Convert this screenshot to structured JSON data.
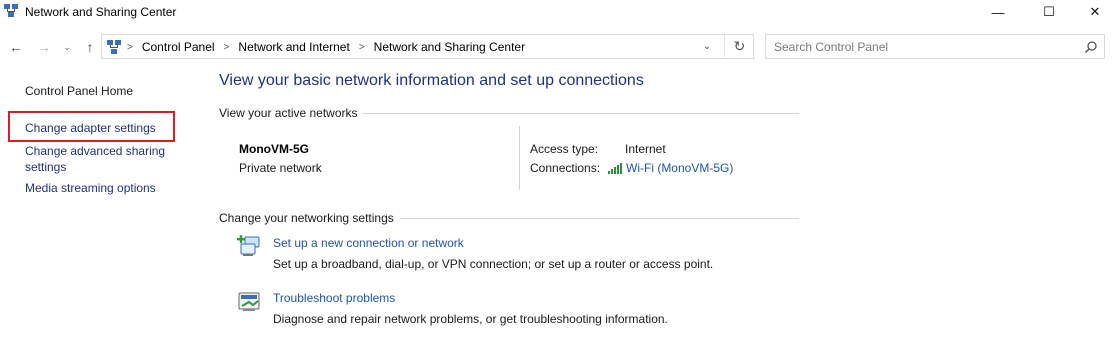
{
  "window": {
    "title": "Network and Sharing Center",
    "minimize": "—",
    "maximize": "☐",
    "close": "✕"
  },
  "nav": {
    "back": "←",
    "forward": "→",
    "recent": "⌄",
    "up": "↑"
  },
  "breadcrumb": {
    "items": [
      "Control Panel",
      "Network and Internet",
      "Network and Sharing Center"
    ],
    "separator": ">",
    "dropdown": "⌄",
    "refresh": "↻"
  },
  "search": {
    "placeholder": "Search Control Panel"
  },
  "sidebar": {
    "items": [
      {
        "label": "Control Panel Home"
      },
      {
        "label": "Change adapter settings"
      },
      {
        "label": "Change advanced sharing settings"
      },
      {
        "label": "Media streaming options"
      }
    ],
    "highlight_color": "#e01b24"
  },
  "main": {
    "title": "View your basic network information and set up connections",
    "active_networks_header": "View your active networks",
    "network": {
      "name": "MonoVM-5G",
      "category": "Private network",
      "access_type_label": "Access type:",
      "access_type_value": "Internet",
      "connections_label": "Connections:",
      "connection_link": "Wi-Fi (MonoVM-5G)"
    },
    "change_settings_header": "Change your networking settings",
    "tasks": [
      {
        "link": "Set up a new connection or network",
        "description": "Set up a broadband, dial-up, or VPN connection; or set up a router or access point.",
        "icon": "new-connection-icon"
      },
      {
        "link": "Troubleshoot problems",
        "description": "Diagnose and repair network problems, or get troubleshooting information.",
        "icon": "troubleshoot-icon"
      }
    ]
  },
  "colors": {
    "link": "#1e55a8",
    "title": "#1e3287",
    "signal": "#2f8f3a"
  }
}
